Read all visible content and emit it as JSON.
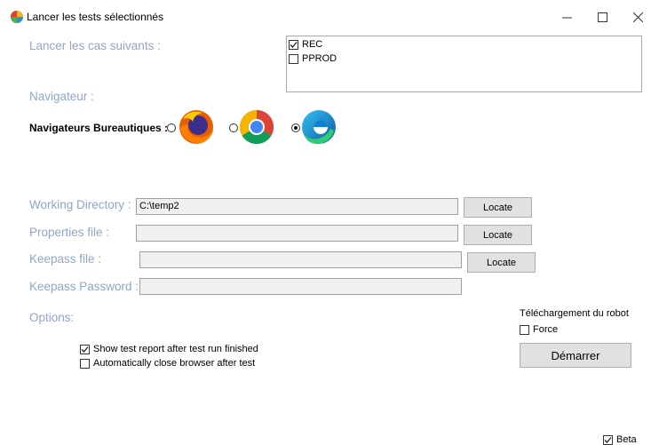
{
  "window": {
    "title": "Lancer les tests sélectionnés",
    "controls": {
      "minimize_icon": "minimize-icon",
      "maximize_icon": "maximize-icon",
      "close_icon": "close-icon"
    }
  },
  "cases": {
    "label": "Lancer les cas suivants :",
    "items": [
      {
        "label": "REC",
        "checked": true
      },
      {
        "label": "PPROD",
        "checked": false
      }
    ]
  },
  "browser": {
    "section_label": "Navigateur :",
    "desktop_label": "Navigateurs Bureautiques :",
    "options": [
      {
        "icon": "firefox-icon",
        "selected": false
      },
      {
        "icon": "chrome-icon",
        "selected": false
      },
      {
        "icon": "edge-icon",
        "selected": true
      }
    ]
  },
  "fields": {
    "working_directory": {
      "label": "Working Directory :",
      "value": "C:\\temp2",
      "button": "Locate"
    },
    "properties_file": {
      "label": "Properties file :",
      "value": "",
      "button": "Locate"
    },
    "keepass_file": {
      "label": "Keepass file :",
      "value": "",
      "button": "Locate"
    },
    "keepass_password": {
      "label": "Keepass Password :",
      "value": ""
    }
  },
  "options": {
    "label": "Options:",
    "show_report": {
      "label": "Show test report after test run finished",
      "checked": true
    },
    "auto_close": {
      "label": "Automatically close browser after test",
      "checked": false
    }
  },
  "robot": {
    "title": "Téléchargement du robot",
    "force": {
      "label": "Force",
      "checked": false
    },
    "start_button": "Démarrer"
  },
  "beta": {
    "label": "Beta",
    "checked": true
  }
}
